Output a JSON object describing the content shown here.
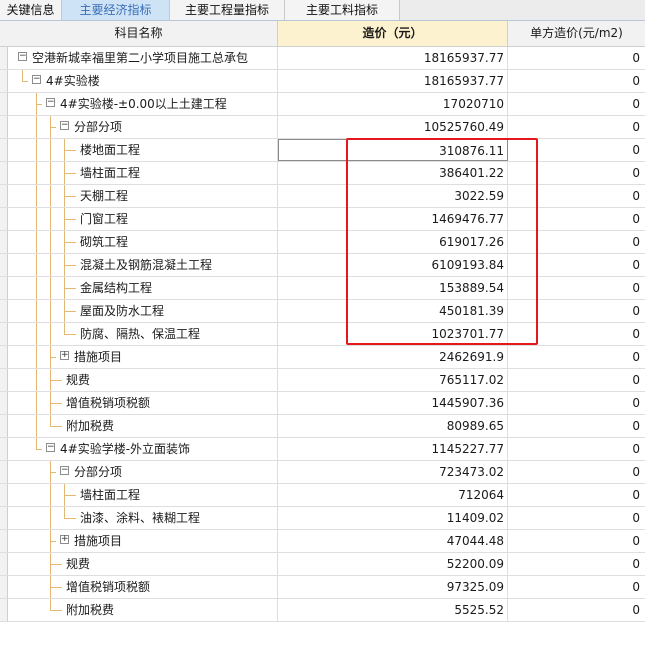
{
  "tabs": [
    {
      "label": "关键信息",
      "active": false
    },
    {
      "label": "主要经济指标",
      "active": true
    },
    {
      "label": "主要工程量指标",
      "active": false
    },
    {
      "label": "主要工料指标",
      "active": false
    }
  ],
  "columns": {
    "name": "科目名称",
    "cost": "造价（元）",
    "unit_cost": "单方造价(元/m2)"
  },
  "rows": [
    {
      "level": 0,
      "toggle": "minus",
      "name": "空港新城幸福里第二小学项目施工总承包",
      "cost": "18165937.77",
      "unit": "0"
    },
    {
      "level": 1,
      "toggle": "minus",
      "name": "4#实验楼",
      "cost": "18165937.77",
      "unit": "0"
    },
    {
      "level": 2,
      "toggle": "minus",
      "name": "4#实验楼-±0.00以上土建工程",
      "cost": "17020710",
      "unit": "0"
    },
    {
      "level": 3,
      "toggle": "minus",
      "name": "分部分项",
      "cost": "10525760.49",
      "unit": "0"
    },
    {
      "level": 4,
      "toggle": "",
      "name": "楼地面工程",
      "cost": "310876.11",
      "unit": "0"
    },
    {
      "level": 4,
      "toggle": "",
      "name": "墙柱面工程",
      "cost": "386401.22",
      "unit": "0"
    },
    {
      "level": 4,
      "toggle": "",
      "name": "天棚工程",
      "cost": "3022.59",
      "unit": "0"
    },
    {
      "level": 4,
      "toggle": "",
      "name": "门窗工程",
      "cost": "1469476.77",
      "unit": "0"
    },
    {
      "level": 4,
      "toggle": "",
      "name": "砌筑工程",
      "cost": "619017.26",
      "unit": "0"
    },
    {
      "level": 4,
      "toggle": "",
      "name": "混凝土及钢筋混凝土工程",
      "cost": "6109193.84",
      "unit": "0"
    },
    {
      "level": 4,
      "toggle": "",
      "name": "金属结构工程",
      "cost": "153889.54",
      "unit": "0"
    },
    {
      "level": 4,
      "toggle": "",
      "name": "屋面及防水工程",
      "cost": "450181.39",
      "unit": "0"
    },
    {
      "level": 4,
      "toggle": "",
      "name": "防腐、隔热、保温工程",
      "cost": "1023701.77",
      "unit": "0"
    },
    {
      "level": 3,
      "toggle": "plus",
      "name": "措施项目",
      "cost": "2462691.9",
      "unit": "0"
    },
    {
      "level": 3,
      "toggle": "",
      "name": "规费",
      "cost": "765117.02",
      "unit": "0"
    },
    {
      "level": 3,
      "toggle": "",
      "name": "增值税销项税额",
      "cost": "1445907.36",
      "unit": "0"
    },
    {
      "level": 3,
      "toggle": "",
      "name": "附加税费",
      "cost": "80989.65",
      "unit": "0"
    },
    {
      "level": 2,
      "toggle": "minus",
      "name": "4#实验学楼-外立面装饰",
      "cost": "1145227.77",
      "unit": "0"
    },
    {
      "level": 3,
      "toggle": "minus",
      "name": "分部分项",
      "cost": "723473.02",
      "unit": "0"
    },
    {
      "level": 4,
      "toggle": "",
      "name": "墙柱面工程",
      "cost": "712064",
      "unit": "0"
    },
    {
      "level": 4,
      "toggle": "",
      "name": "油漆、涂料、裱糊工程",
      "cost": "11409.02",
      "unit": "0"
    },
    {
      "level": 3,
      "toggle": "plus",
      "name": "措施项目",
      "cost": "47044.48",
      "unit": "0"
    },
    {
      "level": 3,
      "toggle": "",
      "name": "规费",
      "cost": "52200.09",
      "unit": "0"
    },
    {
      "level": 3,
      "toggle": "",
      "name": "增值税销项税额",
      "cost": "97325.09",
      "unit": "0"
    },
    {
      "level": 3,
      "toggle": "",
      "name": "附加税费",
      "cost": "5525.52",
      "unit": "0"
    }
  ],
  "colors": {
    "accent": "#3b6fb5",
    "highlight": "#e4181c",
    "selected_header": "#fdf2cf"
  }
}
